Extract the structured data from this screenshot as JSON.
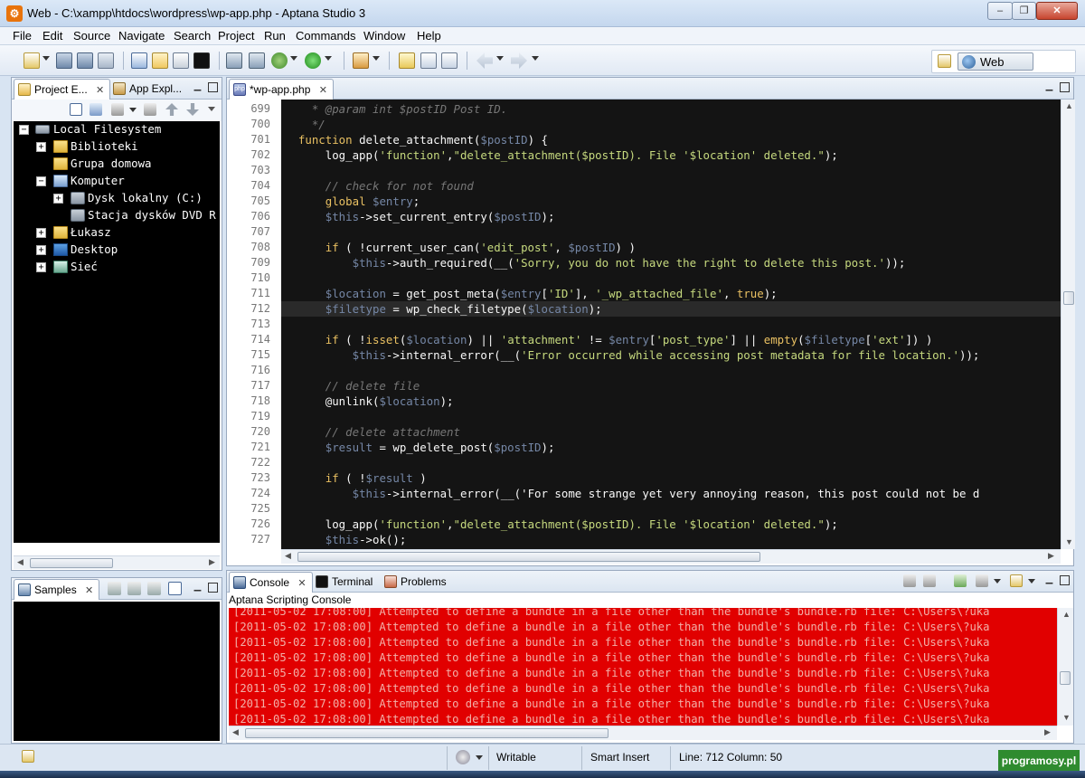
{
  "window": {
    "title": "Web - C:\\xampp\\htdocs\\wordpress\\wp-app.php - Aptana Studio 3",
    "min": "–",
    "max": "❐",
    "close": "✕"
  },
  "menu": [
    "File",
    "Edit",
    "Source",
    "Navigate",
    "Search",
    "Project",
    "Run",
    "Commands",
    "Window",
    "Help"
  ],
  "perspective": {
    "label": "Web"
  },
  "project": {
    "tabs": [
      {
        "label": "Project E..."
      },
      {
        "label": "App Expl..."
      }
    ],
    "tree": [
      {
        "label": "Local Filesystem",
        "toggle": "−",
        "level": 0,
        "icon": "drive-icon"
      },
      {
        "label": "Biblioteki",
        "toggle": "+",
        "level": 1,
        "icon": "folder-icon"
      },
      {
        "label": "Grupa domowa",
        "toggle": "",
        "level": 1,
        "icon": "folder-icon"
      },
      {
        "label": "Komputer",
        "toggle": "−",
        "level": 1,
        "icon": "folder-icon"
      },
      {
        "label": "Dysk lokalny (C:)",
        "toggle": "+",
        "level": 2,
        "icon": "drive-icon"
      },
      {
        "label": "Stacja dysków DVD R",
        "toggle": "",
        "level": 2,
        "icon": "drive-icon"
      },
      {
        "label": "Łukasz",
        "toggle": "+",
        "level": 1,
        "icon": "folder-icon"
      },
      {
        "label": "Desktop",
        "toggle": "+",
        "level": 1,
        "icon": "desktop-icon"
      },
      {
        "label": "Sieć",
        "toggle": "+",
        "level": 1,
        "icon": "folder-icon"
      }
    ]
  },
  "samples": {
    "tab": "Samples"
  },
  "editor": {
    "tab": "*wp-app.php",
    "current_line": 712,
    "lines": [
      {
        "n": "699",
        "code": "    * @param int $postID Post ID."
      },
      {
        "n": "700",
        "code": "    */"
      },
      {
        "n": "701",
        "code": "  function delete_attachment($postID) {"
      },
      {
        "n": "702",
        "code": "      log_app('function',\"delete_attachment($postID). File '$location' deleted.\");"
      },
      {
        "n": "703",
        "code": ""
      },
      {
        "n": "704",
        "code": "      // check for not found"
      },
      {
        "n": "705",
        "code": "      global $entry;"
      },
      {
        "n": "706",
        "code": "      $this->set_current_entry($postID);"
      },
      {
        "n": "707",
        "code": ""
      },
      {
        "n": "708",
        "code": "      if ( !current_user_can('edit_post', $postID) )"
      },
      {
        "n": "709",
        "code": "          $this->auth_required(__('Sorry, you do not have the right to delete this post.'));"
      },
      {
        "n": "710",
        "code": ""
      },
      {
        "n": "711",
        "code": "      $location = get_post_meta($entry['ID'], '_wp_attached_file', true);"
      },
      {
        "n": "712",
        "code": "      $filetype = wp_check_filetype($location);"
      },
      {
        "n": "713",
        "code": ""
      },
      {
        "n": "714",
        "code": "      if ( !isset($location) || 'attachment' != $entry['post_type'] || empty($filetype['ext']) )"
      },
      {
        "n": "715",
        "code": "          $this->internal_error(__('Error occurred while accessing post metadata for file location.'));"
      },
      {
        "n": "716",
        "code": ""
      },
      {
        "n": "717",
        "code": "      // delete file"
      },
      {
        "n": "718",
        "code": "      @unlink($location);"
      },
      {
        "n": "719",
        "code": ""
      },
      {
        "n": "720",
        "code": "      // delete attachment"
      },
      {
        "n": "721",
        "code": "      $result = wp_delete_post($postID);"
      },
      {
        "n": "722",
        "code": ""
      },
      {
        "n": "723",
        "code": "      if ( !$result )"
      },
      {
        "n": "724",
        "code": "          $this->internal_error(__('For some strange yet very annoying reason, this post could not be d"
      },
      {
        "n": "725",
        "code": ""
      },
      {
        "n": "726",
        "code": "      log_app('function',\"delete_attachment($postID). File '$location' deleted.\");"
      },
      {
        "n": "727",
        "code": "      $this->ok();"
      }
    ]
  },
  "console": {
    "tabs": [
      {
        "label": "Console"
      },
      {
        "label": "Terminal"
      },
      {
        "label": "Problems"
      }
    ],
    "header": "Aptana Scripting Console",
    "lines": [
      "[2011-05-02 17:08:00] Attempted to define a bundle in a file other than the bundle's bundle.rb file: C:\\Users\\?uka",
      "[2011-05-02 17:08:00] Attempted to define a bundle in a file other than the bundle's bundle.rb file: C:\\Users\\?uka",
      "[2011-05-02 17:08:00] Attempted to define a bundle in a file other than the bundle's bundle.rb file: C:\\Users\\?uka",
      "[2011-05-02 17:08:00] Attempted to define a bundle in a file other than the bundle's bundle.rb file: C:\\Users\\?uka",
      "[2011-05-02 17:08:00] Attempted to define a bundle in a file other than the bundle's bundle.rb file: C:\\Users\\?uka",
      "[2011-05-02 17:08:00] Attempted to define a bundle in a file other than the bundle's bundle.rb file: C:\\Users\\?uka",
      "[2011-05-02 17:08:00] Attempted to define a bundle in a file other than the bundle's bundle.rb file: C:\\Users\\?uka",
      "[2011-05-02 17:08:00] Attempted to define a bundle in a file other than the bundle's bundle.rb file: C:\\Users\\?uka"
    ]
  },
  "status": {
    "mode": "Writable",
    "insert": "Smart Insert",
    "position": "Line: 712 Column: 50"
  },
  "watermark": "programosy.pl",
  "colors": {
    "console_bg": "#e10000",
    "editor_bg": "#141414",
    "keyword": "#e9c062",
    "comment": "#777777",
    "string": "#c6d97e",
    "variable": "#7587a6"
  }
}
